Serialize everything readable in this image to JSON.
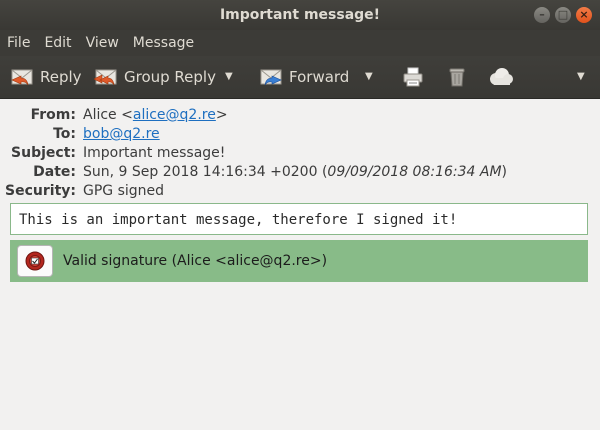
{
  "window": {
    "title": "Important message!"
  },
  "menu": {
    "file": "File",
    "edit": "Edit",
    "view": "View",
    "message": "Message"
  },
  "toolbar": {
    "reply": "Reply",
    "group_reply": "Group Reply",
    "forward": "Forward"
  },
  "headers": {
    "from_label": "From:",
    "from_name": "Alice <",
    "from_email": "alice@q2.re",
    "from_close": ">",
    "to_label": "To:",
    "to_email": "bob@q2.re",
    "subject_label": "Subject:",
    "subject": "Important message!",
    "date_label": "Date:",
    "date": "Sun, 9 Sep 2018 14:16:34 +0200 (",
    "date_local": "09/09/2018 08:16:34 AM",
    "date_close": ")",
    "security_label": "Security:",
    "security": "GPG signed"
  },
  "body_text": "This is an important message, therefore I signed it!",
  "signature": {
    "status": "Valid signature (Alice <alice@q2.re>)"
  }
}
